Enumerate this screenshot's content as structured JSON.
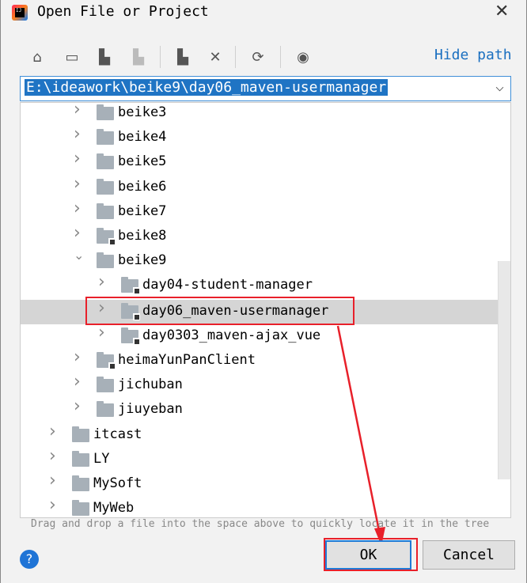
{
  "window": {
    "title": "Open File or Project",
    "close_icon": "close-icon"
  },
  "toolbar": {
    "buttons": [
      "home-icon",
      "desktop-icon",
      "project-folder-icon",
      "module-folder-icon",
      "new-folder-icon",
      "delete-icon",
      "refresh-icon",
      "show-hidden-icon"
    ],
    "hide_path": "Hide path"
  },
  "path": {
    "value": "E:\\ideawork\\beike9\\day06_maven-usermanager"
  },
  "tree": {
    "rows": [
      {
        "label": "beike3",
        "level": 1,
        "expanded": false,
        "project": false
      },
      {
        "label": "beike4",
        "level": 1,
        "expanded": false,
        "project": false
      },
      {
        "label": "beike5",
        "level": 1,
        "expanded": false,
        "project": false
      },
      {
        "label": "beike6",
        "level": 1,
        "expanded": false,
        "project": false
      },
      {
        "label": "beike7",
        "level": 1,
        "expanded": false,
        "project": false
      },
      {
        "label": "beike8",
        "level": 1,
        "expanded": false,
        "project": true
      },
      {
        "label": "beike9",
        "level": 1,
        "expanded": true,
        "project": false
      },
      {
        "label": "day04-student-manager",
        "level": 2,
        "expanded": false,
        "project": true
      },
      {
        "label": "day06_maven-usermanager",
        "level": 2,
        "expanded": false,
        "project": true,
        "selected": true
      },
      {
        "label": "day0303_maven-ajax_vue",
        "level": 2,
        "expanded": false,
        "project": true
      },
      {
        "label": "heimaYunPanClient",
        "level": 1,
        "expanded": false,
        "project": true
      },
      {
        "label": "jichuban",
        "level": 1,
        "expanded": false,
        "project": false
      },
      {
        "label": "jiuyeban",
        "level": 1,
        "expanded": false,
        "project": false
      },
      {
        "label": "itcast",
        "level": 0,
        "expanded": false,
        "project": false
      },
      {
        "label": "LY",
        "level": 0,
        "expanded": false,
        "project": false
      },
      {
        "label": "MySoft",
        "level": 0,
        "expanded": false,
        "project": false
      },
      {
        "label": "MyWeb",
        "level": 0,
        "expanded": false,
        "project": false
      }
    ]
  },
  "hint": "Drag and drop a file into the space above to quickly locate it in the tree",
  "footer": {
    "help": "?",
    "ok": "OK",
    "cancel": "Cancel"
  },
  "colors": {
    "accent": "#1f74c4",
    "annotation": "#e8202a",
    "selection": "#d5d5d5"
  }
}
